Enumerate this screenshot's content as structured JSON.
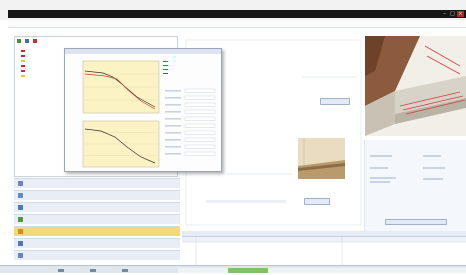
{
  "window": {
    "title": "",
    "buttons": {
      "minimize": "–",
      "maximize": "□",
      "close": "×"
    }
  },
  "tab_title": "",
  "left_tree": {
    "items": [
      {
        "label": "",
        "color": "#cc2b2b"
      },
      {
        "label": "",
        "color": "#cc2b2b"
      },
      {
        "label": "",
        "color": "#e8c43a"
      },
      {
        "label": "",
        "color": "#cc2b2b"
      },
      {
        "label": "",
        "color": "#cc2b2b"
      },
      {
        "label": "",
        "color": "#e8c43a"
      }
    ]
  },
  "nav": {
    "items": [
      {
        "label": "",
        "icon": "globe-icon",
        "selected": false
      },
      {
        "label": "",
        "icon": "grid-icon",
        "selected": false
      },
      {
        "label": "",
        "icon": "layers-icon",
        "selected": false
      },
      {
        "label": "",
        "icon": "pencil-icon",
        "selected": false
      },
      {
        "label": "",
        "icon": "heat-icon",
        "selected": true
      },
      {
        "label": "",
        "icon": "chart-icon",
        "selected": false
      },
      {
        "label": "",
        "icon": "document-icon",
        "selected": false
      }
    ]
  },
  "popup": {
    "chart_top_title": "",
    "chart_bottom_title": "",
    "legend": [
      {
        "label": "",
        "color": "#d23b3b"
      },
      {
        "label": "",
        "color": "#d23b3b"
      },
      {
        "label": "",
        "color": "#d23b3b"
      },
      {
        "label": "",
        "color": "#555555"
      }
    ]
  },
  "content": {
    "section_title": "",
    "button1": "",
    "button2": "",
    "formula1": "",
    "formula2": ""
  },
  "right_panel": {
    "title": "",
    "button": ""
  },
  "bottom": {
    "title": "",
    "columns": [
      "",
      "",
      ""
    ]
  },
  "colors": {
    "accent": "#3b5a9a",
    "selected_nav": "#f6d77a",
    "chart_bg": "#fbf3c4"
  }
}
